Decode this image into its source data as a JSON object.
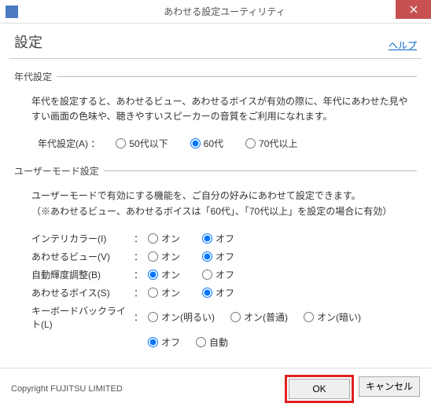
{
  "window": {
    "title": "あわせる設定ユーティリティ"
  },
  "header": {
    "title": "設定",
    "help": "ヘルプ"
  },
  "age_section": {
    "legend": "年代設定",
    "description": "年代を設定すると、あわせるビュー、あわせるボイスが有効の際に、年代にあわせた見やすい画面の色味や、聴きやすいスピーカーの音質をご利用になれます。",
    "label": "年代設定(A) ：",
    "options": {
      "o1": "50代以下",
      "o2": "60代",
      "o3": "70代以上"
    }
  },
  "user_section": {
    "legend": "ユーザーモード設定",
    "description": "ユーザーモードで有効にする機能を、ご自分の好みにあわせて設定できます。\n（※あわせるビュー、あわせるボイスは「60代」、「70代以上」を設定の場合に有効）",
    "rows": {
      "intel": {
        "label": "インテリカラー(I)",
        "on": "オン",
        "off": "オフ"
      },
      "view": {
        "label": "あわせるビュー(V)",
        "on": "オン",
        "off": "オフ"
      },
      "bright": {
        "label": "自動輝度調整(B)",
        "on": "オン",
        "off": "オフ"
      },
      "voice": {
        "label": "あわせるボイス(S)",
        "on": "オン",
        "off": "オフ"
      },
      "kb": {
        "label": "キーボードバックライト(L)",
        "opt1": "オン(明るい)",
        "opt2": "オン(普通)",
        "opt3": "オン(暗い)",
        "opt4": "オフ",
        "opt5": "自動"
      }
    }
  },
  "footer": {
    "copyright": "Copyright FUJITSU LIMITED",
    "ok": "OK",
    "cancel": "キャンセル"
  }
}
